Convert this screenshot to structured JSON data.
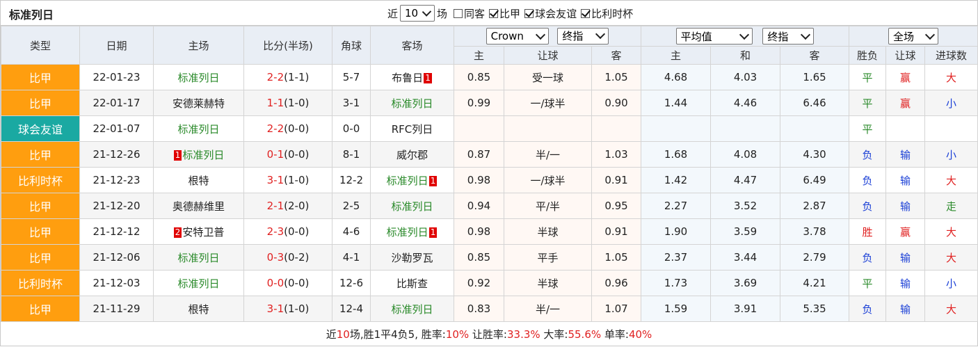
{
  "header": {
    "title": "标准列日",
    "filter_near": "近",
    "filter_count": "10",
    "filter_unit": "场",
    "checkboxes": [
      {
        "label": "同客",
        "checked": false
      },
      {
        "label": "比甲",
        "checked": true
      },
      {
        "label": "球会友谊",
        "checked": true
      },
      {
        "label": "比利时杯",
        "checked": true
      }
    ]
  },
  "table": {
    "columns": [
      "类型",
      "日期",
      "主场",
      "比分(半场)",
      "角球",
      "客场"
    ],
    "odds_company": "Crown",
    "odds_type": "终指",
    "avg_select": "平均值",
    "avg_type": "终指",
    "scope_select": "全场",
    "sub_cols": {
      "odds": [
        "主",
        "让球",
        "客"
      ],
      "avg": [
        "主",
        "和",
        "客"
      ],
      "res": [
        "胜负",
        "让球",
        "进球数"
      ]
    },
    "rows": [
      {
        "league": "比甲",
        "league_color": "orange",
        "date": "22-01-23",
        "home": "标准列日",
        "home_rank": "",
        "home_hl": true,
        "score": "2-2",
        "half": "(1-1)",
        "corner": "5-7",
        "away": "布鲁日",
        "away_rank": "1",
        "away_hl": false,
        "o_home": "0.85",
        "o_hcap": "受一球",
        "o_away": "1.05",
        "a_home": "4.68",
        "a_draw": "4.03",
        "a_away": "1.65",
        "r_wl": "平",
        "r_wl_c": "green",
        "r_hcap": "赢",
        "r_hcap_c": "red",
        "r_goal": "大",
        "r_goal_c": "red"
      },
      {
        "league": "比甲",
        "league_color": "orange",
        "date": "22-01-17",
        "home": "安德莱赫特",
        "home_rank": "",
        "home_hl": false,
        "score": "1-1",
        "half": "(1-0)",
        "corner": "3-1",
        "away": "标准列日",
        "away_rank": "",
        "away_hl": true,
        "o_home": "0.99",
        "o_hcap": "一/球半",
        "o_away": "0.90",
        "a_home": "1.44",
        "a_draw": "4.46",
        "a_away": "6.46",
        "r_wl": "平",
        "r_wl_c": "green",
        "r_hcap": "赢",
        "r_hcap_c": "red",
        "r_goal": "小",
        "r_goal_c": "blue"
      },
      {
        "league": "球会友谊",
        "league_color": "teal",
        "date": "22-01-07",
        "home": "标准列日",
        "home_rank": "",
        "home_hl": true,
        "score": "2-2",
        "half": "(0-0)",
        "corner": "0-0",
        "away": "RFC列日",
        "away_rank": "",
        "away_hl": false,
        "o_home": "",
        "o_hcap": "",
        "o_away": "",
        "a_home": "",
        "a_draw": "",
        "a_away": "",
        "r_wl": "平",
        "r_wl_c": "green",
        "r_hcap": "",
        "r_hcap_c": "red",
        "r_goal": "",
        "r_goal_c": "red"
      },
      {
        "league": "比甲",
        "league_color": "orange",
        "date": "21-12-26",
        "home": "标准列日",
        "home_rank": "1",
        "home_hl": true,
        "score": "0-1",
        "half": "(0-0)",
        "corner": "8-1",
        "away": "威尔郡",
        "away_rank": "",
        "away_hl": false,
        "o_home": "0.87",
        "o_hcap": "半/一",
        "o_away": "1.03",
        "a_home": "1.68",
        "a_draw": "4.08",
        "a_away": "4.30",
        "r_wl": "负",
        "r_wl_c": "blue",
        "r_hcap": "输",
        "r_hcap_c": "blue",
        "r_goal": "小",
        "r_goal_c": "blue"
      },
      {
        "league": "比利时杯",
        "league_color": "orange",
        "date": "21-12-23",
        "home": "根特",
        "home_rank": "",
        "home_hl": false,
        "score": "3-1",
        "half": "(1-0)",
        "corner": "12-2",
        "away": "标准列日",
        "away_rank": "1",
        "away_hl": true,
        "o_home": "0.98",
        "o_hcap": "一/球半",
        "o_away": "0.91",
        "a_home": "1.42",
        "a_draw": "4.47",
        "a_away": "6.49",
        "r_wl": "负",
        "r_wl_c": "blue",
        "r_hcap": "输",
        "r_hcap_c": "blue",
        "r_goal": "大",
        "r_goal_c": "red"
      },
      {
        "league": "比甲",
        "league_color": "orange",
        "date": "21-12-20",
        "home": "奥德赫维里",
        "home_rank": "",
        "home_hl": false,
        "score": "2-1",
        "half": "(2-0)",
        "corner": "2-5",
        "away": "标准列日",
        "away_rank": "",
        "away_hl": true,
        "o_home": "0.94",
        "o_hcap": "平/半",
        "o_away": "0.95",
        "a_home": "2.27",
        "a_draw": "3.52",
        "a_away": "2.87",
        "r_wl": "负",
        "r_wl_c": "blue",
        "r_hcap": "输",
        "r_hcap_c": "blue",
        "r_goal": "走",
        "r_goal_c": "green"
      },
      {
        "league": "比甲",
        "league_color": "orange",
        "date": "21-12-12",
        "home": "安特卫普",
        "home_rank": "2",
        "home_hl": false,
        "score": "2-3",
        "half": "(0-0)",
        "corner": "4-6",
        "away": "标准列日",
        "away_rank": "1",
        "away_hl": true,
        "o_home": "0.98",
        "o_hcap": "半球",
        "o_away": "0.91",
        "a_home": "1.90",
        "a_draw": "3.59",
        "a_away": "3.78",
        "r_wl": "胜",
        "r_wl_c": "red",
        "r_hcap": "赢",
        "r_hcap_c": "red",
        "r_goal": "大",
        "r_goal_c": "red"
      },
      {
        "league": "比甲",
        "league_color": "orange",
        "date": "21-12-06",
        "home": "标准列日",
        "home_rank": "",
        "home_hl": true,
        "score": "0-3",
        "half": "(0-2)",
        "corner": "4-1",
        "away": "沙勒罗瓦",
        "away_rank": "",
        "away_hl": false,
        "o_home": "0.85",
        "o_hcap": "平手",
        "o_away": "1.05",
        "a_home": "2.37",
        "a_draw": "3.44",
        "a_away": "2.79",
        "r_wl": "负",
        "r_wl_c": "blue",
        "r_hcap": "输",
        "r_hcap_c": "blue",
        "r_goal": "大",
        "r_goal_c": "red"
      },
      {
        "league": "比利时杯",
        "league_color": "orange",
        "date": "21-12-03",
        "home": "标准列日",
        "home_rank": "",
        "home_hl": true,
        "score": "0-0",
        "half": "(0-0)",
        "corner": "12-6",
        "away": "比斯查",
        "away_rank": "",
        "away_hl": false,
        "o_home": "0.92",
        "o_hcap": "半球",
        "o_away": "0.96",
        "a_home": "1.73",
        "a_draw": "3.69",
        "a_away": "4.21",
        "r_wl": "平",
        "r_wl_c": "green",
        "r_hcap": "输",
        "r_hcap_c": "blue",
        "r_goal": "小",
        "r_goal_c": "blue"
      },
      {
        "league": "比甲",
        "league_color": "orange",
        "date": "21-11-29",
        "home": "根特",
        "home_rank": "",
        "home_hl": false,
        "score": "3-1",
        "half": "(1-0)",
        "corner": "12-4",
        "away": "标准列日",
        "away_rank": "",
        "away_hl": true,
        "o_home": "0.83",
        "o_hcap": "半/一",
        "o_away": "1.07",
        "a_home": "1.59",
        "a_draw": "3.91",
        "a_away": "5.35",
        "r_wl": "负",
        "r_wl_c": "blue",
        "r_hcap": "输",
        "r_hcap_c": "blue",
        "r_goal": "大",
        "r_goal_c": "red"
      }
    ]
  },
  "summary": {
    "p1": "近",
    "count": "10",
    "p2": "场,胜1平4负5, 胜率:",
    "win_rate": "10%",
    "p3": " 让胜率:",
    "hcap_rate": "33.3%",
    "p4": " 大率:",
    "big_rate": "55.6%",
    "p5": " 单率:",
    "odd_rate": "40%"
  }
}
